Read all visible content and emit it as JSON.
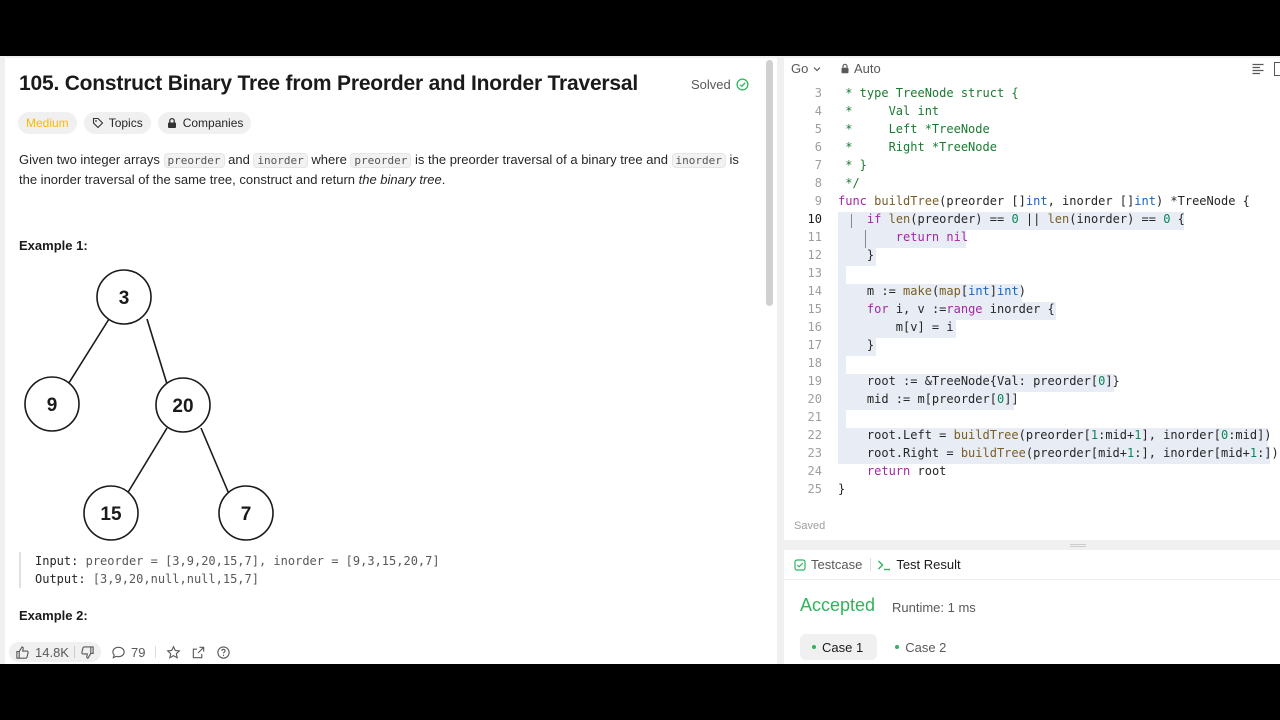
{
  "problem": {
    "title": "105. Construct Binary Tree from Preorder and Inorder Traversal",
    "status": "Solved",
    "difficulty": "Medium",
    "topics_label": "Topics",
    "companies_label": "Companies",
    "description": {
      "p1": "Given two integer arrays ",
      "code1": "preorder",
      "p2": " and ",
      "code2": "inorder",
      "p3": " where ",
      "code3": "preorder",
      "p4": " is the preorder traversal of a binary tree and ",
      "code4": "inorder",
      "p5": " is the inorder traversal of the same tree, construct and return ",
      "em": "the binary tree",
      "p6": "."
    },
    "example1_title": "Example 1:",
    "tree_nodes": [
      {
        "id": "n3",
        "label": "3"
      },
      {
        "id": "n9",
        "label": "9"
      },
      {
        "id": "n20",
        "label": "20"
      },
      {
        "id": "n15",
        "label": "15"
      },
      {
        "id": "n7",
        "label": "7"
      }
    ],
    "example1": {
      "input_key": "Input:",
      "input_val": "preorder = [3,9,20,15,7], inorder = [9,3,15,20,7]",
      "output_key": "Output:",
      "output_val": "[3,9,20,null,null,15,7]"
    },
    "example2_title": "Example 2:",
    "likes": "14.8K",
    "comments": "79"
  },
  "editor": {
    "language": "Go",
    "mode": "Auto",
    "saved_label": "Saved",
    "current_line": "10",
    "lines": [
      {
        "n": "3",
        "text": " * type TreeNode struct {"
      },
      {
        "n": "4",
        "text": " *     Val int"
      },
      {
        "n": "5",
        "text": " *     Left *TreeNode"
      },
      {
        "n": "6",
        "text": " *     Right *TreeNode"
      },
      {
        "n": "7",
        "text": " * }"
      },
      {
        "n": "8",
        "text": " */"
      },
      {
        "n": "9",
        "text": "func buildTree(preorder []int, inorder []int) *TreeNode {"
      },
      {
        "n": "10",
        "text": "    if len(preorder) == 0 || len(inorder) == 0 {"
      },
      {
        "n": "11",
        "text": "        return nil"
      },
      {
        "n": "12",
        "text": "    }"
      },
      {
        "n": "13",
        "text": ""
      },
      {
        "n": "14",
        "text": "    m := make(map[int]int)"
      },
      {
        "n": "15",
        "text": "    for i, v :=range inorder {"
      },
      {
        "n": "16",
        "text": "        m[v] = i"
      },
      {
        "n": "17",
        "text": "    }"
      },
      {
        "n": "18",
        "text": ""
      },
      {
        "n": "19",
        "text": "    root := &TreeNode{Val: preorder[0]}"
      },
      {
        "n": "20",
        "text": "    mid := m[preorder[0]]"
      },
      {
        "n": "21",
        "text": ""
      },
      {
        "n": "22",
        "text": "    root.Left = buildTree(preorder[1:mid+1], inorder[0:mid])"
      },
      {
        "n": "23",
        "text": "    root.Right = buildTree(preorder[mid+1:], inorder[mid+1:])"
      },
      {
        "n": "24",
        "text": "    return root"
      },
      {
        "n": "25",
        "text": "}"
      }
    ]
  },
  "results": {
    "tab_testcase": "Testcase",
    "tab_result": "Test Result",
    "verdict": "Accepted",
    "runtime": "Runtime: 1 ms",
    "cases": [
      "Case 1",
      "Case 2"
    ]
  },
  "colors": {
    "accepted": "#2db55d",
    "medium": "#ffb800",
    "selection": "#e8edf5"
  }
}
